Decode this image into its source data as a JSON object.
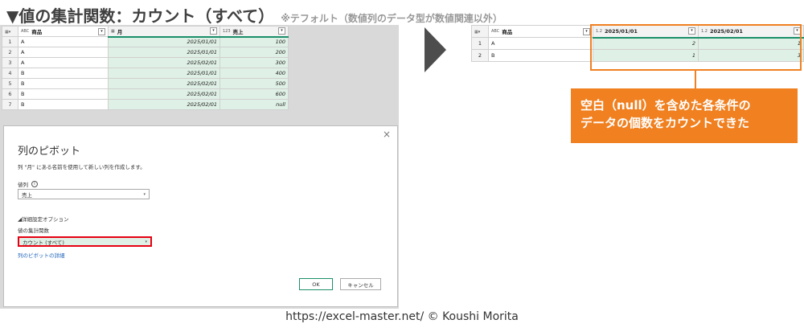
{
  "heading": {
    "main": "▼値の集計関数：カウント（すべて）",
    "sub": "※テフォルト（数値列のデータ型が数値関連以外）"
  },
  "source_table": {
    "columns": [
      {
        "type_icon": "ABC",
        "label": "商品"
      },
      {
        "type_icon": "▦",
        "label": "月"
      },
      {
        "type_icon": "123",
        "label": "売上"
      }
    ],
    "rows": [
      {
        "n": "1",
        "product": "A",
        "month": "2025/01/01",
        "sales": "100"
      },
      {
        "n": "2",
        "product": "A",
        "month": "2025/01/01",
        "sales": "200"
      },
      {
        "n": "3",
        "product": "A",
        "month": "2025/02/01",
        "sales": "300"
      },
      {
        "n": "4",
        "product": "B",
        "month": "2025/01/01",
        "sales": "400"
      },
      {
        "n": "5",
        "product": "B",
        "month": "2025/02/01",
        "sales": "500"
      },
      {
        "n": "6",
        "product": "B",
        "month": "2025/02/01",
        "sales": "600"
      },
      {
        "n": "7",
        "product": "B",
        "month": "2025/02/01",
        "sales": "null"
      }
    ]
  },
  "dialog": {
    "close": "×",
    "title": "列のピボット",
    "description": "列 \"月\" にある名前を使用して新しい列を作成します。",
    "values_label": "値列",
    "info_icon": "i",
    "values_selected": "売上",
    "advanced_toggle": "◢詳細設定オプション",
    "agg_label": "値の集計関数",
    "agg_selected": "カウント (すべて)",
    "link": "列のピボットの詳細",
    "ok": "OK",
    "cancel": "キャンセル"
  },
  "result_table": {
    "columns": [
      {
        "type_icon": "ABC",
        "label": "商品"
      },
      {
        "type_icon": "1.2",
        "label": "2025/01/01"
      },
      {
        "type_icon": "1.2",
        "label": "2025/02/01"
      }
    ],
    "rows": [
      {
        "n": "1",
        "product": "A",
        "v1": "2",
        "v2": "1"
      },
      {
        "n": "2",
        "product": "B",
        "v1": "1",
        "v2": "3"
      }
    ]
  },
  "callout": {
    "line1": "空白（null）を含めた各条件の",
    "line2": "データの個数をカウントできた"
  },
  "footer": "https://excel-master.net/  © Koushi Morita",
  "colors": {
    "accent_orange": "#f08020",
    "highlight_red": "#e60012",
    "selected_green": "#dff0e6",
    "ok_border": "#1b8f6a"
  }
}
